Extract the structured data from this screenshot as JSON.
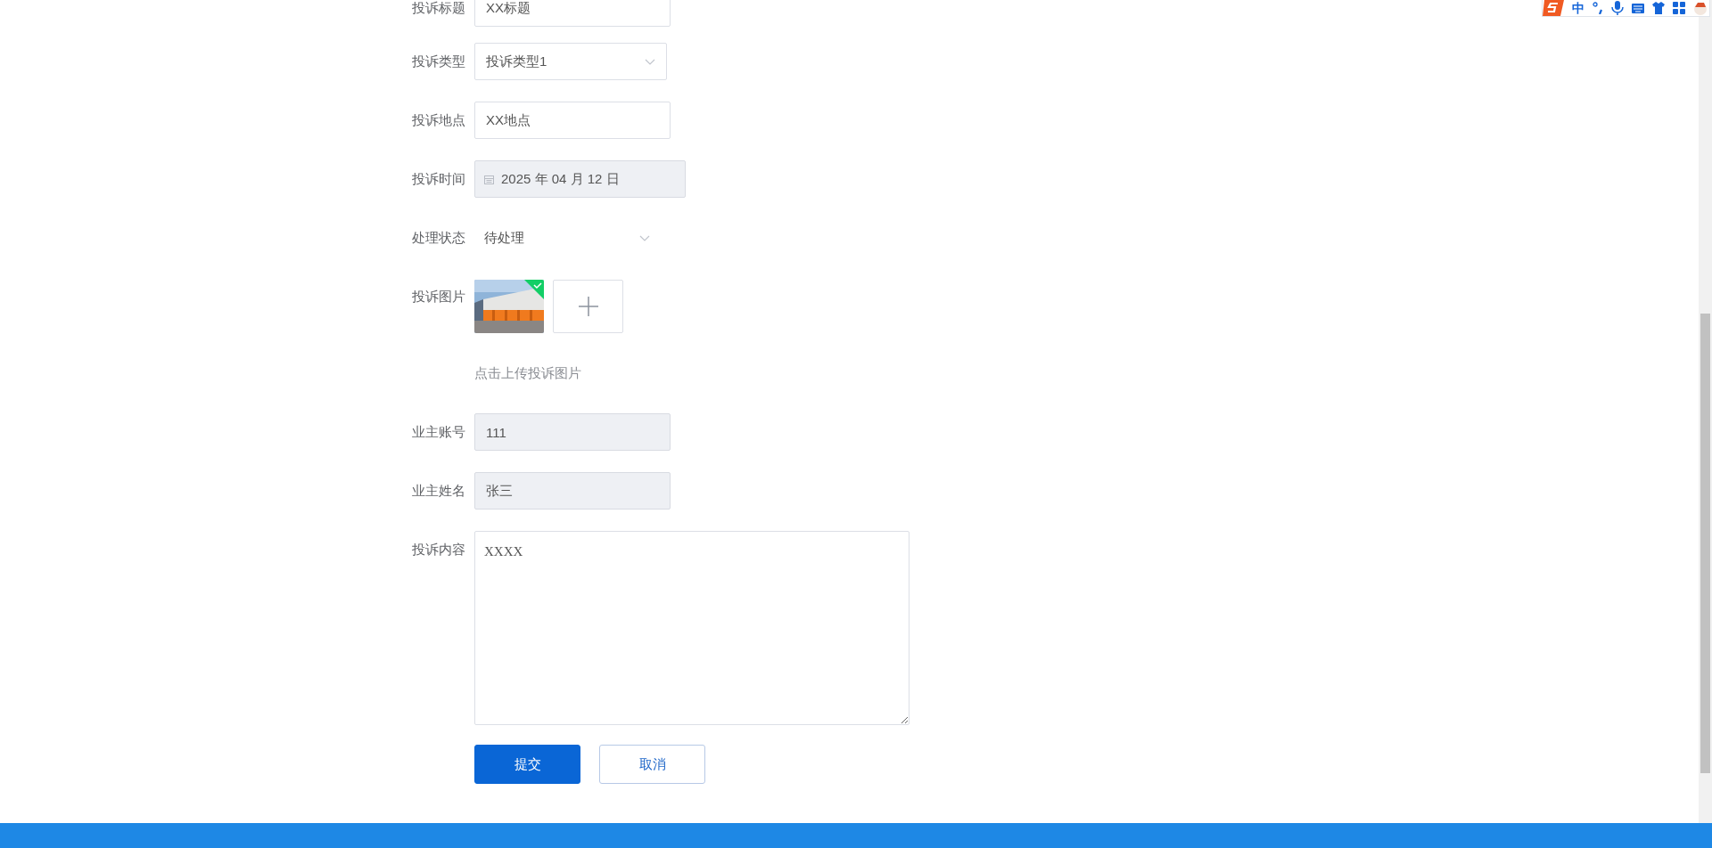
{
  "ime_toolbar": {
    "mode": "中"
  },
  "form": {
    "fields": [
      {
        "label": "投诉标题",
        "kind": "input",
        "value": "XX标题",
        "disabled": false
      },
      {
        "label": "投诉类型",
        "kind": "select",
        "value": "投诉类型1",
        "bordered": true
      },
      {
        "label": "投诉地点",
        "kind": "input",
        "value": "XX地点",
        "disabled": false
      },
      {
        "label": "投诉时间",
        "kind": "date",
        "value": "2025 年 04 月 12 日",
        "disabled": true
      },
      {
        "label": "处理状态",
        "kind": "select",
        "value": "待处理",
        "bordered": false
      },
      {
        "label": "投诉图片",
        "kind": "upload",
        "images": [
          {
            "kind": "picture",
            "uploaded": true
          }
        ],
        "hint": "点击上传投诉图片"
      },
      {
        "label": "业主账号",
        "kind": "input",
        "value": "111",
        "disabled": true
      },
      {
        "label": "业主姓名",
        "kind": "input",
        "value": "张三",
        "disabled": true
      },
      {
        "label": "投诉内容",
        "kind": "textarea",
        "value": "XXXX"
      }
    ],
    "buttons": [
      {
        "label": "提交",
        "kind": "primary"
      },
      {
        "label": "取消",
        "kind": "default"
      }
    ]
  }
}
